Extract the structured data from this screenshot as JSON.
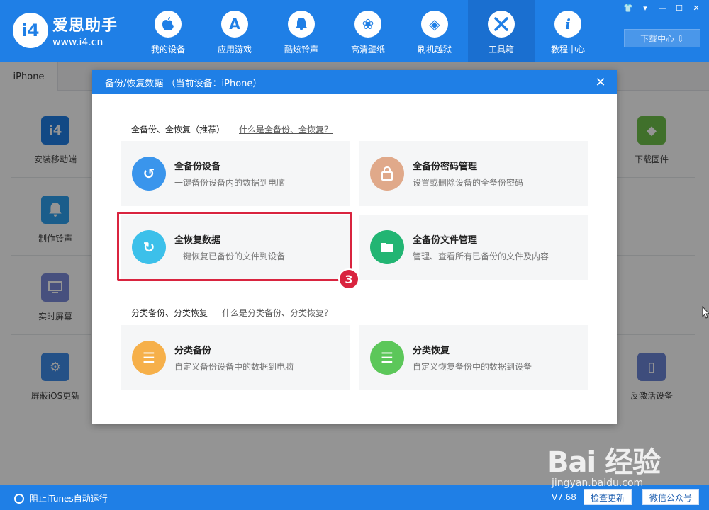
{
  "app": {
    "logo_mark": "i4",
    "logo_cn": "爱思助手",
    "logo_url": "www.i4.cn"
  },
  "nav": [
    {
      "label": "我的设备",
      "icon": "apple-icon",
      "glyph": ""
    },
    {
      "label": "应用游戏",
      "icon": "app-store-icon",
      "glyph": "A"
    },
    {
      "label": "酷炫铃声",
      "icon": "bell-icon",
      "glyph": "♪"
    },
    {
      "label": "高清壁纸",
      "icon": "flower-icon",
      "glyph": "❀"
    },
    {
      "label": "刷机越狱",
      "icon": "box-icon",
      "glyph": "◈"
    },
    {
      "label": "工具箱",
      "icon": "tools-icon",
      "glyph": "✕"
    },
    {
      "label": "教程中心",
      "icon": "info-icon",
      "glyph": "i"
    }
  ],
  "window_controls": [
    "👕",
    "▾",
    "—",
    "☐",
    "✕"
  ],
  "download_center": "下载中心 ⇩",
  "device_tab": "iPhone",
  "tools_left": [
    {
      "label": "安装移动端",
      "glyph": "i4",
      "color": "#1f7fe6"
    },
    {
      "label": "制作铃声",
      "glyph": "🔔",
      "color": "#2ea0f0"
    },
    {
      "label": "实时屏幕",
      "glyph": "▭",
      "color": "#7b8ad9"
    },
    {
      "label": "屏蔽iOS更新",
      "glyph": "⚙",
      "color": "#3f8ce8"
    }
  ],
  "tools_right": [
    {
      "label": "下载固件",
      "glyph": "◆",
      "color": "#6fc24a"
    },
    {
      "label": "反激活设备",
      "glyph": "▯",
      "color": "#6c85d6"
    }
  ],
  "dialog": {
    "title": "备份/恢复数据  （当前设备：iPhone）",
    "close": "✕",
    "section1": {
      "title": "全备份、全恢复（推荐）",
      "link": "什么是全备份、全恢复？"
    },
    "section2": {
      "title": "分类备份、分类恢复",
      "link": "什么是分类备份、分类恢复？"
    },
    "cards": [
      {
        "title": "全备份设备",
        "desc": "一键备份设备内的数据到电脑",
        "color": "#3a95ec",
        "glyph": "↺"
      },
      {
        "title": "全备份密码管理",
        "desc": "设置或删除设备的全备份密码",
        "color": "#e0a98a",
        "glyph": "🔒"
      },
      {
        "title": "全恢复数据",
        "desc": "一键恢复已备份的文件到设备",
        "color": "#3cc0ea",
        "glyph": "↻"
      },
      {
        "title": "全备份文件管理",
        "desc": "管理、查看所有已备份的文件及内容",
        "color": "#22b573",
        "glyph": "▰"
      },
      {
        "title": "分类备份",
        "desc": "自定义备份设备中的数据到电脑",
        "color": "#f6b04a",
        "glyph": "☰"
      },
      {
        "title": "分类恢复",
        "desc": "自定义恢复备份中的数据到设备",
        "color": "#5cc75a",
        "glyph": "☰"
      }
    ]
  },
  "step_badge": "3",
  "status": {
    "itunes_toggle": "阻止iTunes自动运行",
    "version": "V7.68",
    "check_update": "检查更新",
    "wechat": "微信公众号"
  },
  "watermark": {
    "logo": "Bai 经验",
    "url": "jingyan.baidu.com"
  },
  "colors": {
    "primary": "#1f7fe6",
    "highlight": "#d9243f"
  }
}
